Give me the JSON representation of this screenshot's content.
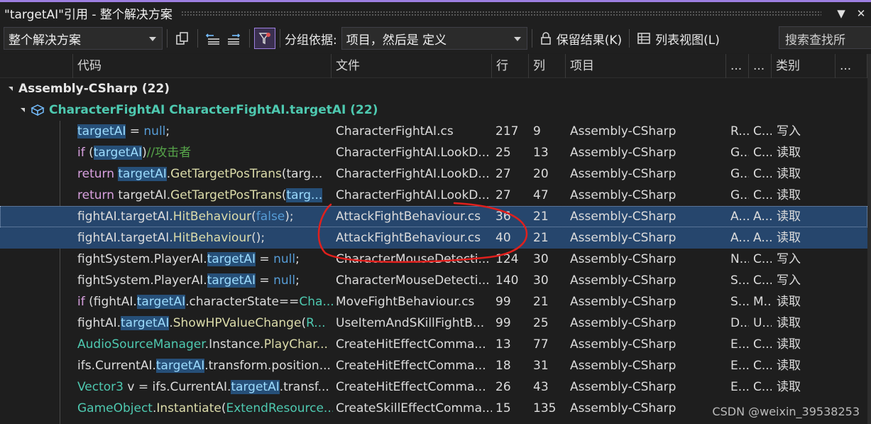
{
  "title": "\"targetAI\"引用 - 整个解决方案",
  "title_buttons": [
    "▼",
    "✕"
  ],
  "toolbar": {
    "scope": "整个解决方案",
    "group_by_label": "分组依据:",
    "group_by_value": "项目，然后是 定义",
    "keep_results": "保留结果(K)",
    "list_view": "列表视图(L)",
    "search_placeholder": "搜索查找所"
  },
  "columns": [
    "代码",
    "文件",
    "行",
    "列",
    "项目",
    "...",
    "...",
    "类别",
    "..."
  ],
  "tree": {
    "project": "Assembly-CSharp  (22)",
    "definition": "CharacterFightAI CharacterFightAI.targetAI  (22)"
  },
  "rows": [
    {
      "file": "CharacterFightAI.cs",
      "line": "217",
      "col": "9",
      "project": "Assembly-CSharp",
      "a": "R...",
      "b": "C...",
      "kind": "写入"
    },
    {
      "file": "CharacterFightAI.LookD...",
      "line": "25",
      "col": "13",
      "project": "Assembly-CSharp",
      "a": "G...",
      "b": "C...",
      "kind": "读取"
    },
    {
      "file": "CharacterFightAI.LookD...",
      "line": "27",
      "col": "20",
      "project": "Assembly-CSharp",
      "a": "G...",
      "b": "C...",
      "kind": "读取"
    },
    {
      "file": "CharacterFightAI.LookD...",
      "line": "27",
      "col": "47",
      "project": "Assembly-CSharp",
      "a": "G...",
      "b": "C...",
      "kind": "读取"
    },
    {
      "file": "AttackFightBehaviour.cs",
      "line": "36",
      "col": "21",
      "project": "Assembly-CSharp",
      "a": "A...",
      "b": "A...",
      "kind": "读取"
    },
    {
      "file": "AttackFightBehaviour.cs",
      "line": "40",
      "col": "21",
      "project": "Assembly-CSharp",
      "a": "A...",
      "b": "A...",
      "kind": "读取"
    },
    {
      "file": "CharacterMouseDetecti...",
      "line": "124",
      "col": "30",
      "project": "Assembly-CSharp",
      "a": "N...",
      "b": "C...",
      "kind": "写入"
    },
    {
      "file": "CharacterMouseDetecti...",
      "line": "140",
      "col": "30",
      "project": "Assembly-CSharp",
      "a": "S...",
      "b": "C...",
      "kind": "写入"
    },
    {
      "file": "MoveFightBehaviour.cs",
      "line": "99",
      "col": "21",
      "project": "Assembly-CSharp",
      "a": "S...",
      "b": "M...",
      "kind": "读取"
    },
    {
      "file": "UseItemAndSKillFightB...",
      "line": "99",
      "col": "25",
      "project": "Assembly-CSharp",
      "a": "D...",
      "b": "U...",
      "kind": "读取"
    },
    {
      "file": "CreateHitEffectComma...",
      "line": "13",
      "col": "77",
      "project": "Assembly-CSharp",
      "a": "E...",
      "b": "C...",
      "kind": "读取"
    },
    {
      "file": "CreateHitEffectComma...",
      "line": "18",
      "col": "31",
      "project": "Assembly-CSharp",
      "a": "E...",
      "b": "C...",
      "kind": "读取"
    },
    {
      "file": "CreateHitEffectComma...",
      "line": "26",
      "col": "43",
      "project": "Assembly-CSharp",
      "a": "E...",
      "b": "C...",
      "kind": "读取"
    },
    {
      "file": "CreateSkillEffectComma...",
      "line": "15",
      "col": "135",
      "project": "Assembly-CSharp",
      "a": "",
      "b": "",
      "kind": ""
    }
  ],
  "code": [
    [
      {
        "t": "targetAI",
        "c": "hl"
      },
      {
        "t": " = ",
        "c": "op"
      },
      {
        "t": "null",
        "c": "kw"
      },
      {
        "t": ";",
        "c": "op"
      }
    ],
    [
      {
        "t": "if",
        "c": "kw2"
      },
      {
        "t": " (",
        "c": "op"
      },
      {
        "t": "targetAI",
        "c": "hl"
      },
      {
        "t": ")",
        "c": "op"
      },
      {
        "t": "//攻击者",
        "c": "cm"
      }
    ],
    [
      {
        "t": "return",
        "c": "kw2"
      },
      {
        "t": " ",
        "c": "op"
      },
      {
        "t": "targetAI",
        "c": "hl"
      },
      {
        "t": ".",
        "c": "op"
      },
      {
        "t": "GetTargetPosTrans",
        "c": "fn"
      },
      {
        "t": "(targ...",
        "c": "op"
      }
    ],
    [
      {
        "t": "return",
        "c": "kw2"
      },
      {
        "t": " targetAI.",
        "c": "op"
      },
      {
        "t": "GetTargetPosTrans",
        "c": "fn"
      },
      {
        "t": "(",
        "c": "op"
      },
      {
        "t": "targ...",
        "c": "hl"
      }
    ],
    [
      {
        "t": "fightAI.targetAI.",
        "c": "op"
      },
      {
        "t": "HitBehaviour",
        "c": "fn"
      },
      {
        "t": "(",
        "c": "op"
      },
      {
        "t": "false",
        "c": "kw"
      },
      {
        "t": ");",
        "c": "op"
      }
    ],
    [
      {
        "t": "fightAI.targetAI.",
        "c": "op"
      },
      {
        "t": "HitBehaviour",
        "c": "fn"
      },
      {
        "t": "();",
        "c": "op"
      }
    ],
    [
      {
        "t": "fightSystem.PlayerAI.",
        "c": "op"
      },
      {
        "t": "targetAI",
        "c": "hl"
      },
      {
        "t": " = ",
        "c": "op"
      },
      {
        "t": "null",
        "c": "kw"
      },
      {
        "t": ";",
        "c": "op"
      }
    ],
    [
      {
        "t": "fightSystem.PlayerAI.",
        "c": "op"
      },
      {
        "t": "targetAI",
        "c": "hl"
      },
      {
        "t": " = ",
        "c": "op"
      },
      {
        "t": "null",
        "c": "kw"
      },
      {
        "t": ";",
        "c": "op"
      }
    ],
    [
      {
        "t": "if",
        "c": "kw2"
      },
      {
        "t": " (fightAI.",
        "c": "op"
      },
      {
        "t": "targetAI",
        "c": "hl"
      },
      {
        "t": ".characterState==",
        "c": "op"
      },
      {
        "t": "Cha...",
        "c": "ty"
      }
    ],
    [
      {
        "t": "fightAI.",
        "c": "op"
      },
      {
        "t": "targetAI",
        "c": "hl"
      },
      {
        "t": ".",
        "c": "op"
      },
      {
        "t": "ShowHPValueChange",
        "c": "fn"
      },
      {
        "t": "(",
        "c": "op"
      },
      {
        "t": "R...",
        "c": "ty"
      }
    ],
    [
      {
        "t": "AudioSourceManager",
        "c": "ty"
      },
      {
        "t": ".Instance.",
        "c": "op"
      },
      {
        "t": "PlayChar...",
        "c": "fn"
      }
    ],
    [
      {
        "t": "ifs.CurrentAI.",
        "c": "op"
      },
      {
        "t": "targetAI",
        "c": "hl"
      },
      {
        "t": ".transform.position...",
        "c": "op"
      }
    ],
    [
      {
        "t": "Vector3",
        "c": "ty"
      },
      {
        "t": " v = ifs.CurrentAI.",
        "c": "op"
      },
      {
        "t": "targetAI",
        "c": "hl"
      },
      {
        "t": ".transf...",
        "c": "op"
      }
    ],
    [
      {
        "t": "GameObject",
        "c": "ty"
      },
      {
        "t": ".",
        "c": "op"
      },
      {
        "t": "Instantiate",
        "c": "fn"
      },
      {
        "t": "(",
        "c": "op"
      },
      {
        "t": "ExtendResource...",
        "c": "ty"
      }
    ]
  ],
  "code_colors": {
    "op": "#dcdcdc",
    "kw": "#569cd6",
    "kw2": "#d8a0df",
    "cm": "#57a64a",
    "fn": "#dcdcaa",
    "ty": "#4ec9b0",
    "hl": "#9cdcfe"
  },
  "watermark": "CSDN @weixin_39538253",
  "accent_color": "#9d7fe0",
  "annotation_color": "#e0201d"
}
